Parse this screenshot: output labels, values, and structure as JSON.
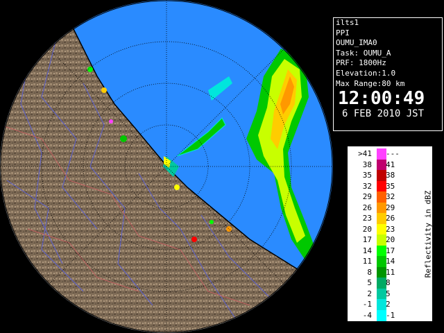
{
  "info": {
    "station": "ilts1",
    "scan_type": "PPI",
    "site": "OUMU_IMA0",
    "task": "Task: OUMU_A",
    "prf": "PRF: 1800Hz",
    "elevation": "Elevation:1.0",
    "max_range": "Max Range:80 km",
    "time": "12:00:49",
    "date": "6 FEB 2010 JST"
  },
  "legend": {
    "unit_label": "Reflectivity in dBZ",
    "rows": [
      {
        "low": ">41",
        "high": "---",
        "color": "#ff40ff"
      },
      {
        "low": "38",
        "high": "41",
        "color": "#c0006e"
      },
      {
        "low": "35",
        "high": "38",
        "color": "#c00000"
      },
      {
        "low": "32",
        "high": "35",
        "color": "#ff0000"
      },
      {
        "low": "29",
        "high": "32",
        "color": "#ff6000"
      },
      {
        "low": "26",
        "high": "29",
        "color": "#ff9800"
      },
      {
        "low": "23",
        "high": "26",
        "color": "#ffcc00"
      },
      {
        "low": "20",
        "high": "23",
        "color": "#ffff00"
      },
      {
        "low": "17",
        "high": "20",
        "color": "#c8ff00"
      },
      {
        "low": "14",
        "high": "17",
        "color": "#00ff00"
      },
      {
        "low": "11",
        "high": "14",
        "color": "#00c800"
      },
      {
        "low": "8",
        "high": "11",
        "color": "#009600"
      },
      {
        "low": "5",
        "high": "8",
        "color": "#00aa64"
      },
      {
        "low": "2",
        "high": "5",
        "color": "#00c8a0"
      },
      {
        "low": "-1",
        "high": "2",
        "color": "#00e6dc"
      },
      {
        "low": "-4",
        "high": "-1",
        "color": "#00ffff"
      }
    ]
  },
  "colors": {
    "sea": "#2a8bff",
    "land": "#8a7560",
    "background": "#000000"
  }
}
